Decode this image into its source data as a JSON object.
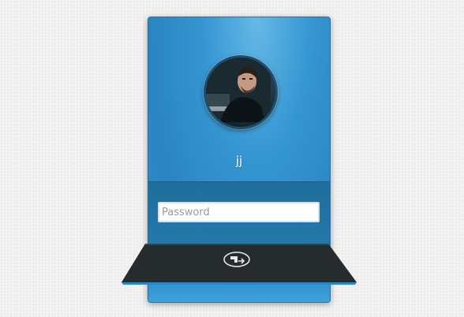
{
  "user": {
    "name": "jj"
  },
  "password": {
    "placeholder": "Password",
    "value": ""
  },
  "dock": {
    "login_icon": "login-arrow-icon"
  },
  "colors": {
    "card_blue": "#2a85c2",
    "card_highlight": "#66b9e6",
    "dock_dark": "#262b2e",
    "page_background": "#f1f1f1"
  }
}
